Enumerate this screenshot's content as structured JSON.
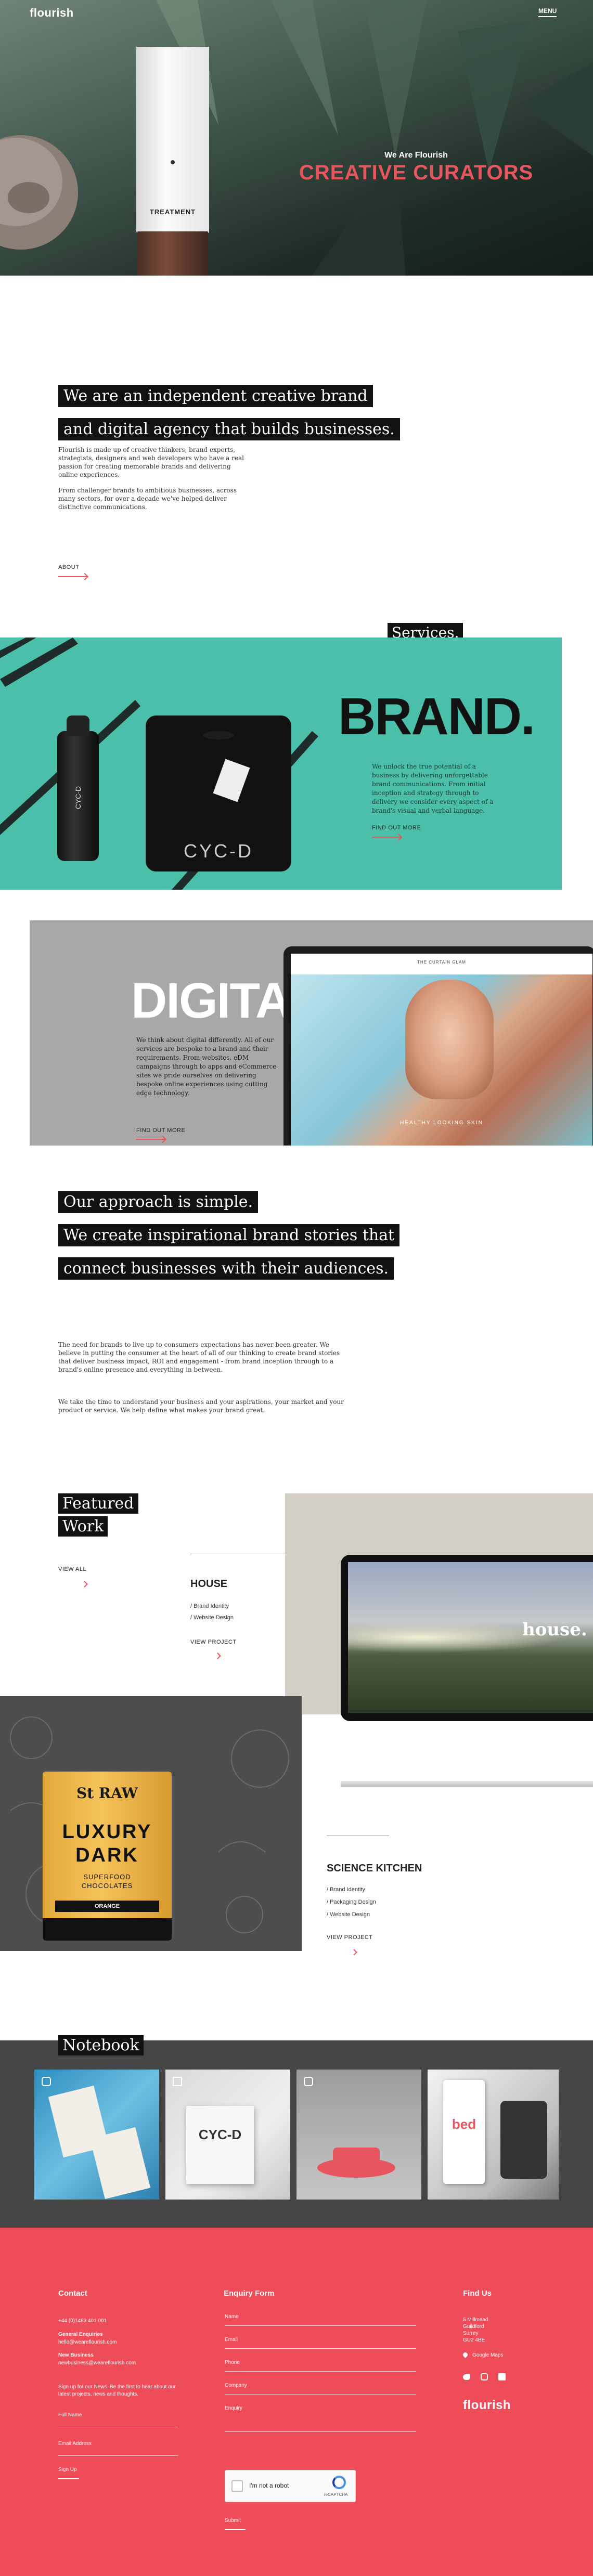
{
  "header": {
    "logo": "flourish",
    "menu_label": "MENU"
  },
  "hero": {
    "eyebrow": "We Are Flourish",
    "title": "CREATIVE CURATORS",
    "product_label": "TREATMENT"
  },
  "intro": {
    "headline_1": "We are an independent creative brand",
    "headline_2": "and digital agency that builds businesses.",
    "para_1": "Flourish is made up of creative thinkers, brand experts, strategists, designers and web developers who have a real passion for creating memorable brands and delivering online experiences.",
    "para_2": "From challenger brands to ambitious businesses, across many sectors, for over a decade we've helped deliver distinctive communications.",
    "link": "ABOUT"
  },
  "services": {
    "label": "Services.",
    "brand_title": "BRAND.",
    "brand_text": "We unlock the true potential of a business by delivering unforgettable brand communications. From initial inception and strategy through to delivery we consider every aspect of a brand's visual and verbal language.",
    "brand_link": "FIND OUT MORE",
    "bottle_label": "CYC-D",
    "shirt_label": "CYC-D",
    "digital_title": "DIGITAL.",
    "digital_text": "We think about digital differently. All of our services are bespoke to a brand and their requirements. From websites, eDM campaigns through to apps and eCommerce sites we pride ourselves on delivering bespoke online experiences using cutting edge technology.",
    "digital_link": "FIND OUT MORE",
    "laptop_brand": "THE CURTAIN GLAM",
    "laptop_caption": "HEALTHY LOOKING SKIN"
  },
  "approach": {
    "line_1": "Our approach is simple.",
    "line_2": "We create inspirational brand stories that",
    "line_3": "connect businesses with their audiences.",
    "para_1": "The need for brands to live up to consumers expectations has never been greater. We believe in putting the consumer at the heart of all of our thinking to create brand stories that deliver business impact, ROI and engagement - from brand inception through to a brand's online presence and everything in between.",
    "para_2": "We take the time to understand your business and your aspirations, your market and your product or service. We help define what makes your brand great."
  },
  "featured": {
    "title_1": "Featured",
    "title_2": "Work",
    "view_all": "VIEW ALL",
    "house": {
      "title": "HOUSE",
      "tags": [
        "/ Brand Identity",
        "/ Website Design"
      ],
      "link": "VIEW PROJECT",
      "screen_text": "house."
    },
    "science": {
      "title": "SCIENCE KITCHEN",
      "tags": [
        "/ Brand Identity",
        "/ Packaging Design",
        "/ Website Design"
      ],
      "link": "VIEW PROJECT",
      "pack": {
        "brand": "St RAW",
        "line1": "LUXURY",
        "line2": "DARK",
        "sub1": "SUPERFOOD",
        "sub2": "CHOCOLATES",
        "flavour": "ORANGE"
      }
    }
  },
  "notebook": {
    "title": "Notebook",
    "tiles": [
      "CYC-D",
      "bed"
    ]
  },
  "footer": {
    "contact": {
      "heading": "Contact",
      "phone": "+44 (0)1483 401 001",
      "general_label": "General Enquiries",
      "general_email": "hello@weareflourish.com",
      "new_label": "New Business",
      "new_email": "newbusiness@weareflourish.com",
      "signup_text": "Sign up for our News. Be the first to hear about our latest projects, news and thoughts.",
      "fullname": "Full Name",
      "email": "Email Address",
      "signup": "Sign Up"
    },
    "enquiry": {
      "heading": "Enquiry Form",
      "fields": [
        "Name",
        "Email",
        "Phone",
        "Company",
        "Enquiry"
      ],
      "captcha": "I'm not a robot",
      "captcha_brand": "reCAPTCHA",
      "submit": "Submit"
    },
    "find": {
      "heading": "Find Us",
      "address": [
        "5 Millmead",
        "Guildford",
        "Surrey",
        "GU2 4BE"
      ],
      "maps": "Google Maps",
      "logo": "flourish"
    }
  },
  "colors": {
    "accent": "#e7555f",
    "teal": "#4bbfa9",
    "footer": "#ee4c58",
    "dark": "#444444"
  }
}
